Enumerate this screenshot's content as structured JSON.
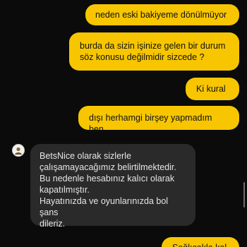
{
  "chat": {
    "messages": [
      {
        "from": "user",
        "text": "neden eski bakiyeme dönülmüyor"
      },
      {
        "from": "user",
        "text": "burda da sizin işinize gelen bir durum\nsöz konusu değilmidir sizcede ?"
      },
      {
        "from": "user",
        "text": "Ki kural"
      },
      {
        "from": "user",
        "text": "dışı herhamgi birşey yapmadım ben"
      },
      {
        "from": "agent",
        "text": "BetsNice olarak sizlerle\nçalışamayacağımız belirtilmektedir.\nBu nedenle hesabınız kalıcı olarak\nkapatılmıştır.\nHayatınızda ve oyunlarınızda bol şans\ndileriz."
      },
      {
        "from": "user",
        "text": "Sağlıcakla kal"
      }
    ]
  },
  "colors": {
    "background": "#0b0b0b",
    "user_bubble": "#f7c600",
    "agent_bubble": "#2a2a2a"
  },
  "icons": {
    "agent_avatar": "agent-avatar-icon"
  }
}
